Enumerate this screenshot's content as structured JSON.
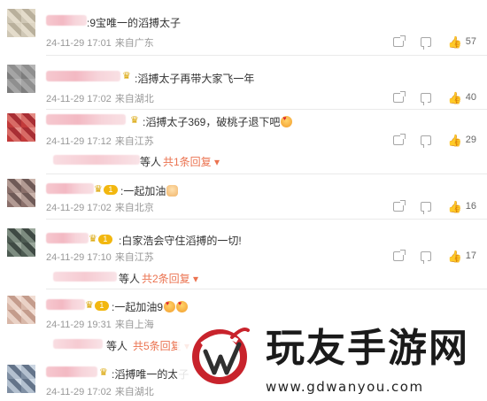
{
  "colors": {
    "link": "#eb7350",
    "meta": "#999999",
    "text": "#333333",
    "badge": "#f2b70f"
  },
  "comments": [
    {
      "text": ":9宝唯一的滔搏太子",
      "date": "24-11-29 17:01",
      "location": "来自广东",
      "likes": "57"
    },
    {
      "text": ":滔搏太子再带大家飞一年",
      "date": "24-11-29 17:02",
      "location": "来自湖北",
      "likes": "40"
    },
    {
      "text": ":滔搏太子369，破桃子退下吧",
      "date": "24-11-29 17:12",
      "location": "来自江苏",
      "likes": "29",
      "replies": {
        "prefix": "等人",
        "link": "共1条回复"
      }
    },
    {
      "text": ":一起加油",
      "date": "24-11-29 17:02",
      "location": "来自北京",
      "likes": "16",
      "badge": "1"
    },
    {
      "text": ":白家浩会守住滔搏的一切!",
      "date": "24-11-29 17:10",
      "location": "来自江苏",
      "likes": "17",
      "badge": "1",
      "replies": {
        "prefix": "等人",
        "link": "共2条回复"
      }
    },
    {
      "text": ":一起加油9",
      "date": "24-11-29 19:31",
      "location": "来自上海",
      "badge": "1",
      "replies": {
        "prefix": "等人",
        "link": "共5条回复"
      }
    },
    {
      "text": ":滔搏唯一的太子",
      "date": "24-11-29 17:02",
      "location": "来自湖北"
    }
  ],
  "watermark": {
    "title": "玩友手游网",
    "url": "www.gdwanyou.com"
  },
  "icons": {
    "share": "share-icon",
    "reply": "comment-icon",
    "like": "thumbs-up-icon",
    "expand": "chevron-down-icon",
    "crown": "crown-icon"
  }
}
